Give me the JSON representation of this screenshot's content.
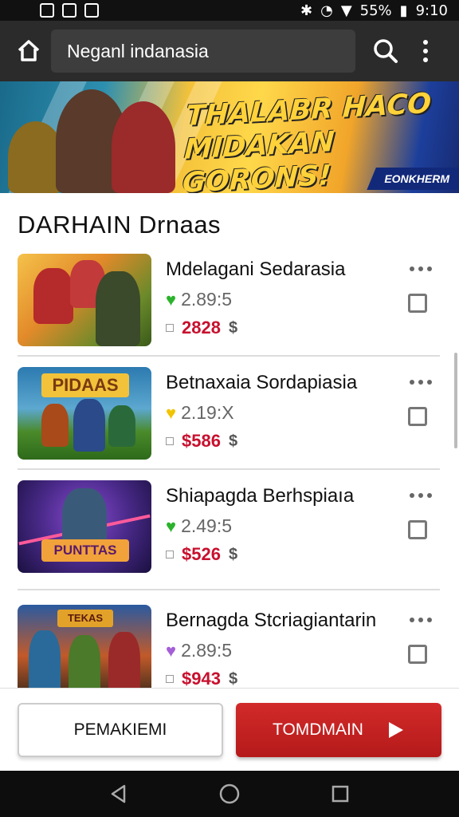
{
  "status_bar": {
    "battery": "55%",
    "time": "9:10"
  },
  "app_bar": {
    "search_value": "Neganl indanasia"
  },
  "banner": {
    "title_line1": "THALABR HACO",
    "title_line2": "MIDAKAN GORONS!",
    "badge": "EONKHERM"
  },
  "section": {
    "title": "DARHAIN Drnaas"
  },
  "items": [
    {
      "title": "Mdelagani Sedarasia",
      "heart_color": "#2bb32b",
      "rating": "2.89:5",
      "price": "2828",
      "suffix": "$"
    },
    {
      "title": "Betnaxaia Sordapiasia",
      "heart_color": "#f2c400",
      "rating": "2.19:X",
      "price": "$586",
      "suffix": "$"
    },
    {
      "title": "Shiapagda Berhspiaıa",
      "heart_color": "#2bb32b",
      "rating": "2.49:5",
      "price": "$526",
      "suffix": "$"
    },
    {
      "title": "Bernagda Stcriagiantarin",
      "heart_color": "#a45ed6",
      "rating": "2.89:5",
      "price": "$943",
      "suffix": "$"
    }
  ],
  "actions": {
    "secondary_label": "PEMAKIEMI",
    "primary_label": "TOMDMAIN"
  },
  "colors": {
    "accent": "#c8102e",
    "app_bar": "#2b2b2b"
  }
}
